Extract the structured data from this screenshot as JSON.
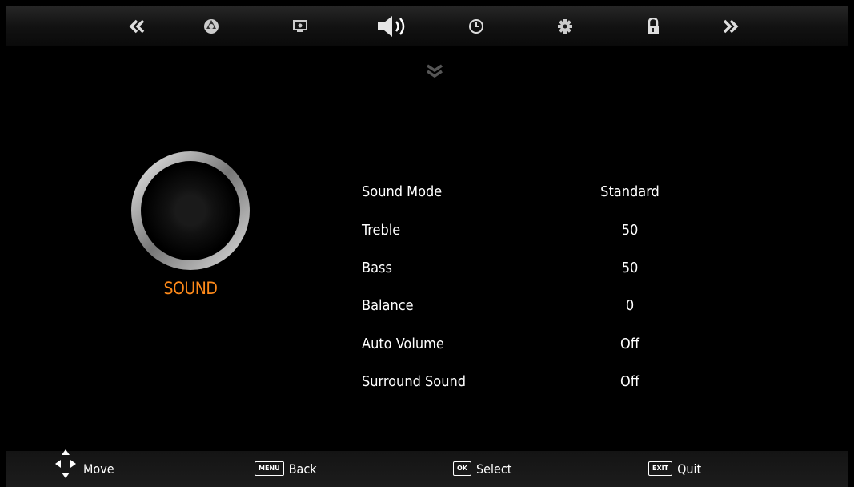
{
  "topbar": {
    "icons": [
      "double-chevron-left-icon",
      "picture-icon",
      "pc-screen-icon",
      "speaker-icon",
      "clock-icon",
      "gear-icon",
      "lock-icon",
      "double-chevron-right-icon"
    ],
    "active_index": 3
  },
  "section": {
    "title": "SOUND"
  },
  "menu": {
    "items": [
      {
        "label": "Sound Mode",
        "value": "Standard"
      },
      {
        "label": "Treble",
        "value": "50"
      },
      {
        "label": "Bass",
        "value": "50"
      },
      {
        "label": "Balance",
        "value": "0"
      },
      {
        "label": "Auto Volume",
        "value": "Off"
      },
      {
        "label": "Surround Sound",
        "value": "Off"
      }
    ]
  },
  "hints": {
    "move": {
      "label": "Move"
    },
    "back": {
      "key": "MENU",
      "label": "Back"
    },
    "select": {
      "key": "OK",
      "label": "Select"
    },
    "quit": {
      "key": "EXIT",
      "label": "Quit"
    }
  },
  "colors": {
    "accent": "#ff8a1a",
    "background": "#000000",
    "text": "#ffffff"
  }
}
